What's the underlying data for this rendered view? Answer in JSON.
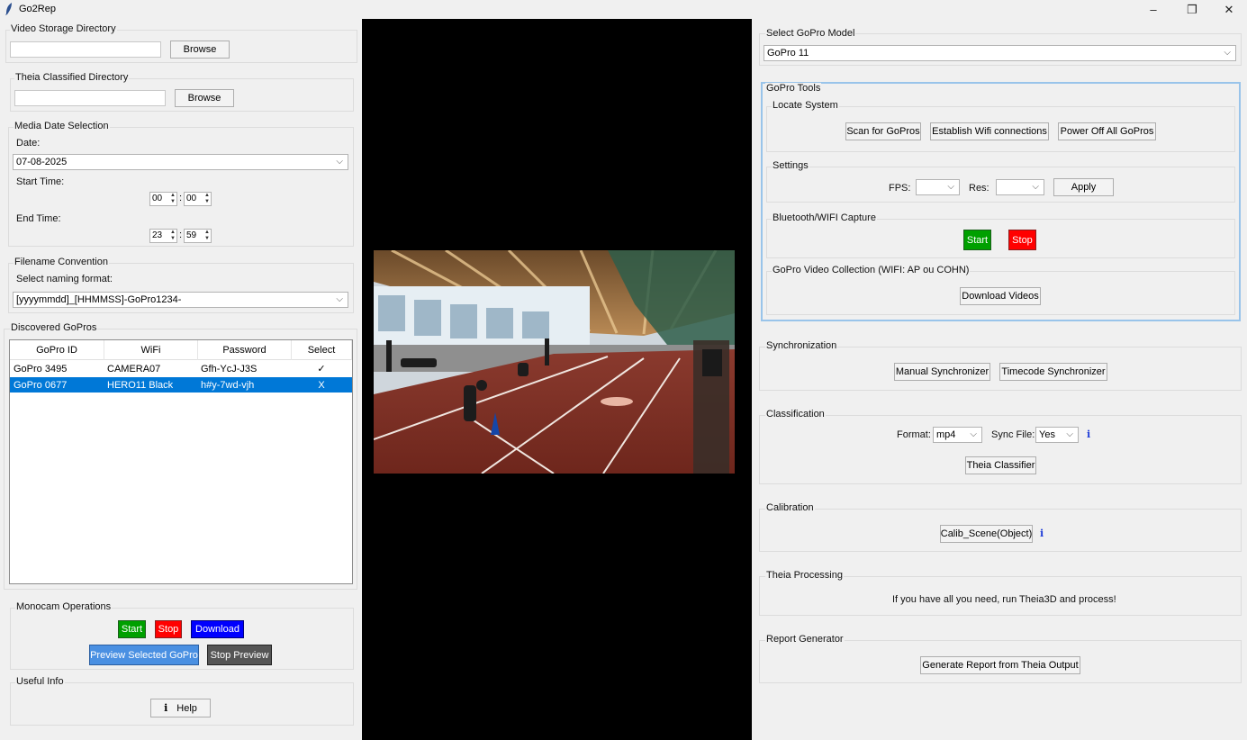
{
  "window": {
    "title": "Go2Rep",
    "controls": [
      "–",
      "❐",
      "✕"
    ]
  },
  "left": {
    "video_storage": {
      "title": "Video Storage Directory",
      "browse": "Browse"
    },
    "theia_dir": {
      "title": "Theia Classified Directory",
      "browse": "Browse"
    },
    "media_date": {
      "title": "Media Date Selection",
      "date_label": "Date:",
      "date_value": "07-08-2025",
      "start_label": "Start Time:",
      "start_hour": "00",
      "start_min": "00",
      "end_label": "End Time:",
      "end_hour": "23",
      "end_min": "59",
      "colon": ":"
    },
    "filename": {
      "title": "Filename Convention",
      "format_label": "Select naming format:",
      "format_value": "[yyyymmdd]_[HHMMSS]-GoPro1234-"
    },
    "discovered": {
      "title": "Discovered GoPros",
      "columns": [
        "GoPro ID",
        "WiFi",
        "Password",
        "Select"
      ],
      "rows": [
        [
          "GoPro 3495",
          "CAMERA07",
          "Gfh-YcJ-J3S",
          "✓"
        ],
        [
          "GoPro 0677",
          "HERO11 Black",
          "h#y-7wd-vjh",
          "X"
        ]
      ]
    },
    "monocam": {
      "title": "Monocam Operations",
      "start": "Start",
      "stop": "Stop",
      "download": "Download",
      "preview": "Preview Selected GoPro",
      "stop_preview": "Stop Preview"
    },
    "useful": {
      "title": "Useful Info",
      "help_icon": "i",
      "help": "Help"
    }
  },
  "right": {
    "model": {
      "title": "Select GoPro Model",
      "value": "GoPro 11"
    },
    "tools": {
      "title": "GoPro Tools",
      "locate": {
        "title": "Locate System",
        "scan": "Scan for GoPros",
        "wifi": "Establish Wifi connections",
        "power": "Power Off All GoPros"
      },
      "settings": {
        "title": "Settings",
        "fps_label": "FPS:",
        "res_label": "Res:",
        "apply": "Apply"
      },
      "bt_capture": {
        "title": "Bluetooth/WIFI Capture",
        "start": "Start",
        "stop": "Stop"
      },
      "collection": {
        "title": "GoPro Video Collection (WIFI: AP ou COHN)",
        "download": "Download Videos"
      }
    },
    "sync": {
      "title": "Synchronization",
      "manual": "Manual Synchronizer",
      "timecode": "Timecode Synchronizer"
    },
    "classification": {
      "title": "Classification",
      "format_label": "Format:",
      "format_value": "mp4",
      "sync_label": "Sync File:",
      "sync_value": "Yes",
      "info": "i",
      "classifier": "Theia Classifier"
    },
    "calibration": {
      "title": "Calibration",
      "button": "Calib_Scene(Object)",
      "info": "i"
    },
    "theia_processing": {
      "title": "Theia Processing",
      "message": "If you have all you need, run Theia3D and process!"
    },
    "report": {
      "title": "Report Generator",
      "button": "Generate Report from Theia Output"
    }
  },
  "colors": {
    "green": "#00a000",
    "red": "#ff0000",
    "blue": "#0000ff",
    "light_blue": "#4a90e2",
    "dark_gray": "#555555",
    "selection": "#0078d7",
    "focus_border": "#99c4ea"
  }
}
